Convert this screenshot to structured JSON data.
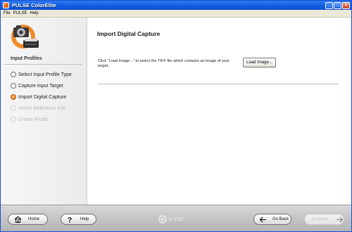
{
  "window": {
    "title": "PULSE ColorElite",
    "controls": {
      "minimize": "_",
      "maximize": "□",
      "close": "×"
    }
  },
  "menu": {
    "file": "File",
    "pulse": "PULSE",
    "help": "Help"
  },
  "sidebar": {
    "heading": "Input Profiles",
    "steps": [
      {
        "label": "Select Input Profile Type",
        "state": "normal"
      },
      {
        "label": "Capture Input Target",
        "state": "normal"
      },
      {
        "label": "Import Digital Capture",
        "state": "active"
      },
      {
        "label": "Select Reference File",
        "state": "disabled"
      },
      {
        "label": "Create Profile",
        "state": "disabled"
      }
    ]
  },
  "main": {
    "title": "Import Digital Capture",
    "instructions": "Click \"Load Image...\" to select the TIFF file which contains an image of your target.",
    "load_button": "Load Image..."
  },
  "footer": {
    "home": "Home",
    "help": "Help",
    "logo": "x·rite",
    "go_back": "Go Back",
    "continue": "Continue"
  },
  "colors": {
    "title_bar": "#1661e8",
    "active_step": "#f08a2c",
    "footer_bar": "#c6c6c6"
  }
}
